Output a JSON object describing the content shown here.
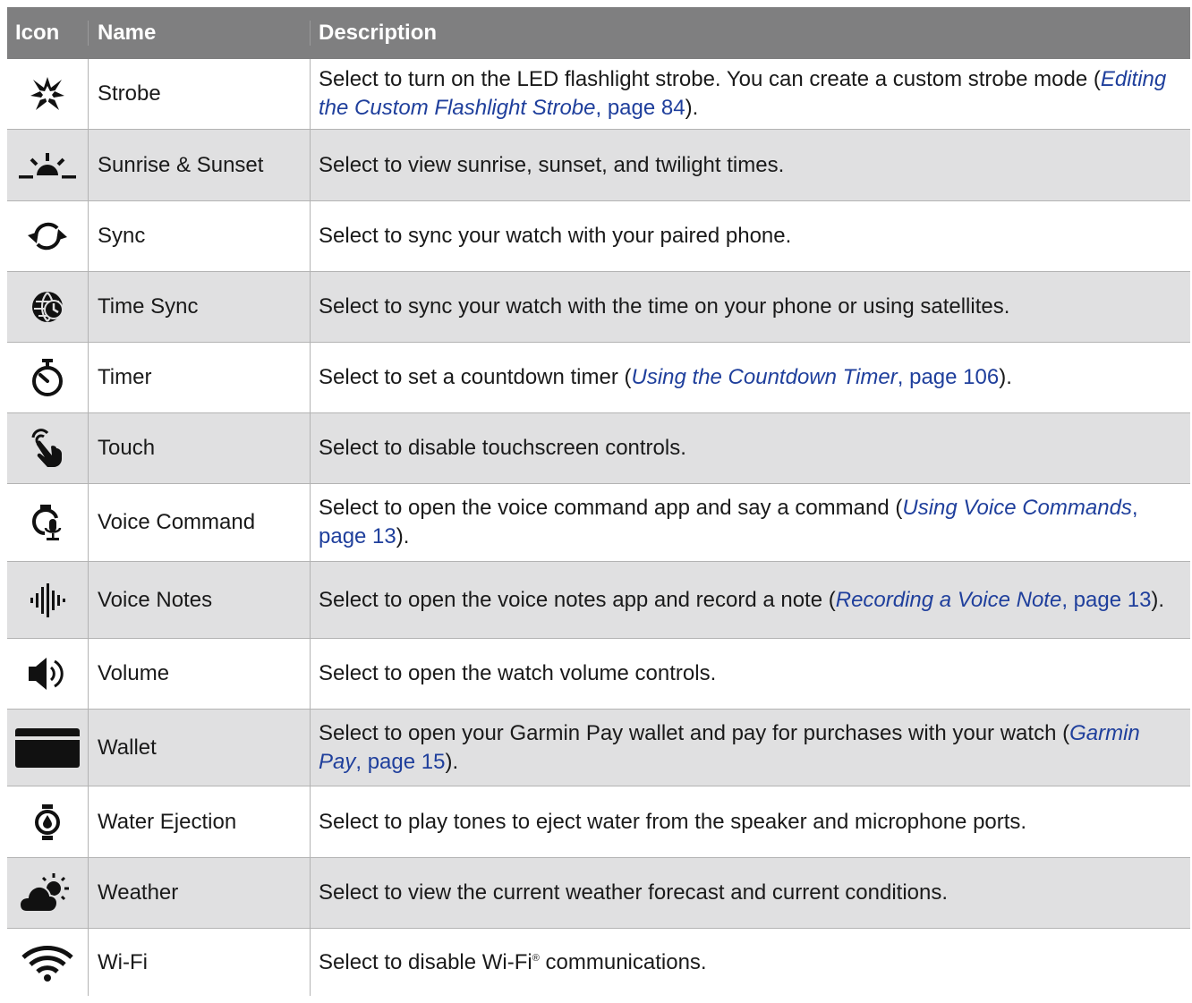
{
  "header": {
    "icon": "Icon",
    "name": "Name",
    "description": "Description"
  },
  "rows": [
    {
      "icon": "strobe-icon",
      "name": "Strobe",
      "d_pre": "Select to turn on the LED flashlight strobe. You can create a custom strobe mode (",
      "d_ref": "Editing the Custom Flashlight Strobe",
      "d_page": ", page 84",
      "d_post": ")."
    },
    {
      "icon": "sunrise-sunset-icon",
      "name": "Sunrise & Sunset",
      "d_pre": "Select to view sunrise, sunset, and twilight times."
    },
    {
      "icon": "sync-icon",
      "name": "Sync",
      "d_pre": "Select to sync your watch with your paired phone."
    },
    {
      "icon": "time-sync-icon",
      "name": "Time Sync",
      "d_pre": "Select to sync your watch with the time on your phone or using satellites."
    },
    {
      "icon": "timer-icon",
      "name": "Timer",
      "d_pre": "Select to set a countdown timer (",
      "d_ref": "Using the Countdown Timer",
      "d_page": ", page 106",
      "d_post": ")."
    },
    {
      "icon": "touch-icon",
      "name": "Touch",
      "d_pre": "Select to disable touchscreen controls."
    },
    {
      "icon": "voice-command-icon",
      "name": "Voice Command",
      "d_pre": "Select to open the voice command app and say a command (",
      "d_ref": "Using Voice Commands",
      "d_page": ", page 13",
      "d_post": ")."
    },
    {
      "icon": "voice-notes-icon",
      "name": "Voice Notes",
      "d_pre": "Select to open the voice notes app and record a note (",
      "d_ref": "Recording a Voice Note",
      "d_page": ", page 13",
      "d_post": ")."
    },
    {
      "icon": "volume-icon",
      "name": "Volume",
      "d_pre": "Select to open the watch volume controls."
    },
    {
      "icon": "wallet-icon",
      "name": "Wallet",
      "d_pre": "Select to open your Garmin Pay wallet and pay for purchases with your watch (",
      "d_ref": "Garmin Pay",
      "d_page": ", page 15",
      "d_post": ")."
    },
    {
      "icon": "water-ejection-icon",
      "name": "Water Ejection",
      "d_pre": "Select to play tones to eject water from the speaker and microphone ports."
    },
    {
      "icon": "weather-icon",
      "name": "Weather",
      "d_pre": "Select to view the current weather forecast and current conditions."
    },
    {
      "icon": "wifi-icon",
      "name": "Wi-Fi",
      "d_pre": "Select to disable Wi-Fi",
      "d_sup": "®",
      "d_post": " communications."
    }
  ]
}
